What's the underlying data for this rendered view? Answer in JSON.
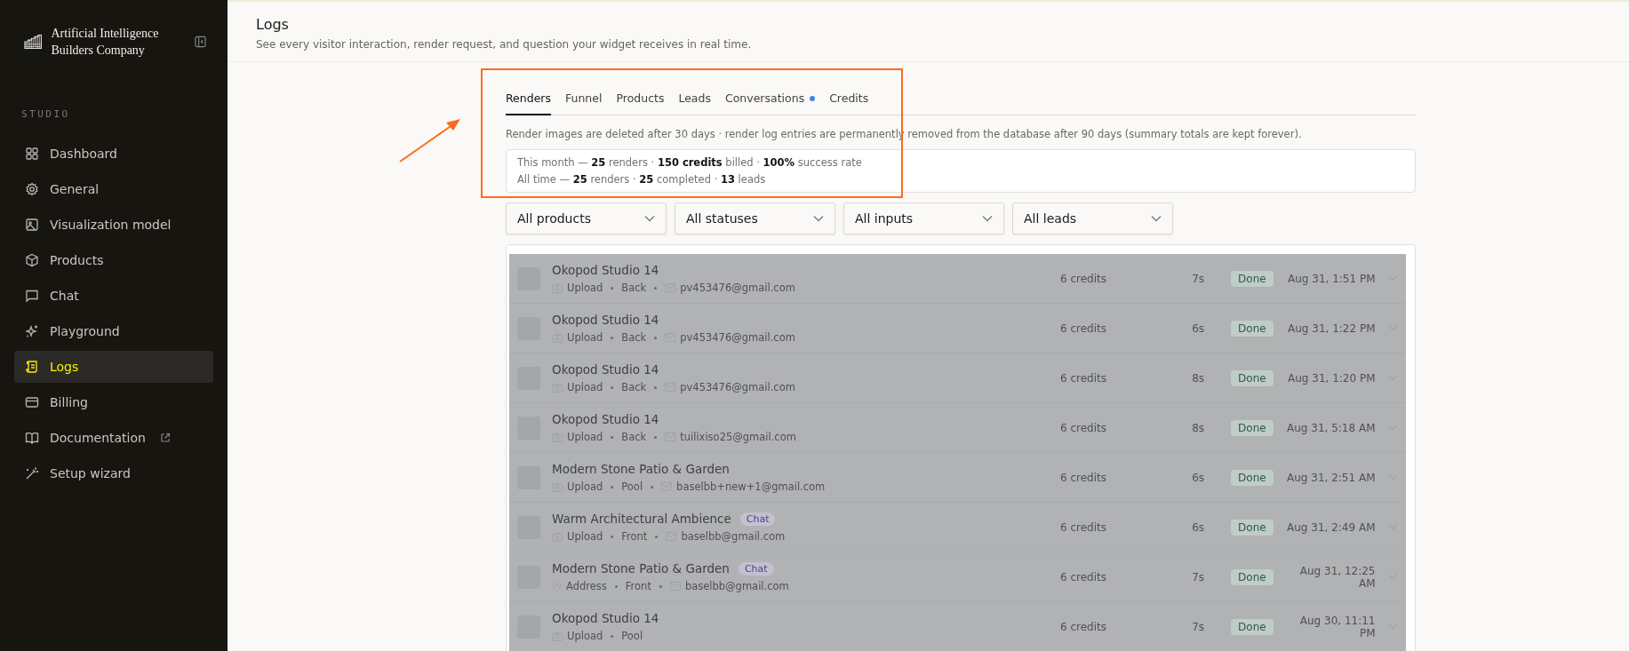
{
  "sidebar": {
    "brand": "Artificial Intelligence Builders Company",
    "section": "STUDIO",
    "items": [
      {
        "label": "Dashboard",
        "selected": false,
        "external": false
      },
      {
        "label": "General",
        "selected": false,
        "external": false
      },
      {
        "label": "Visualization model",
        "selected": false,
        "external": false
      },
      {
        "label": "Products",
        "selected": false,
        "external": false
      },
      {
        "label": "Chat",
        "selected": false,
        "external": false
      },
      {
        "label": "Playground",
        "selected": false,
        "external": false
      },
      {
        "label": "Logs",
        "selected": true,
        "external": false
      },
      {
        "label": "Billing",
        "selected": false,
        "external": false
      },
      {
        "label": "Documentation",
        "selected": false,
        "external": true
      },
      {
        "label": "Setup wizard",
        "selected": false,
        "external": false
      }
    ]
  },
  "header": {
    "title": "Logs",
    "subtitle": "See every visitor interaction, render request, and question your widget receives in real time."
  },
  "tabs": [
    {
      "label": "Renders",
      "selected": true,
      "unread": false
    },
    {
      "label": "Funnel",
      "selected": false,
      "unread": false
    },
    {
      "label": "Products",
      "selected": false,
      "unread": false
    },
    {
      "label": "Leads",
      "selected": false,
      "unread": false
    },
    {
      "label": "Conversations",
      "selected": false,
      "unread": true
    },
    {
      "label": "Credits",
      "selected": false,
      "unread": false
    }
  ],
  "notice": "Render images are deleted after 30 days · render log entries are permanently removed from the database after 90 days (summary totals are kept forever).",
  "summary": [
    "This month — **25** renders · **150 credits** billed · **100%** success rate",
    "All time — **25** renders · **25** completed · **13** leads"
  ],
  "filters": [
    "All products",
    "All statuses",
    "All inputs",
    "All leads"
  ],
  "rows": [
    {
      "title": "Okopod Studio 14",
      "tag": null,
      "kind": "upload",
      "input": "Upload",
      "view": "Back",
      "email": "pv453476@gmail.com",
      "credits": "6 credits",
      "duration": "7s",
      "status": "Done",
      "time": "Aug 31, 1:51 PM"
    },
    {
      "title": "Okopod Studio 14",
      "tag": null,
      "kind": "upload",
      "input": "Upload",
      "view": "Back",
      "email": "pv453476@gmail.com",
      "credits": "6 credits",
      "duration": "6s",
      "status": "Done",
      "time": "Aug 31, 1:22 PM"
    },
    {
      "title": "Okopod Studio 14",
      "tag": null,
      "kind": "upload",
      "input": "Upload",
      "view": "Back",
      "email": "pv453476@gmail.com",
      "credits": "6 credits",
      "duration": "8s",
      "status": "Done",
      "time": "Aug 31, 1:20 PM"
    },
    {
      "title": "Okopod Studio 14",
      "tag": null,
      "kind": "upload",
      "input": "Upload",
      "view": "Back",
      "email": "tuilixiso25@gmail.com",
      "credits": "6 credits",
      "duration": "8s",
      "status": "Done",
      "time": "Aug 31, 5:18 AM"
    },
    {
      "title": "Modern Stone Patio & Garden",
      "tag": null,
      "kind": "upload",
      "input": "Upload",
      "view": "Pool",
      "email": "baselbb+new+1@gmail.com",
      "credits": "6 credits",
      "duration": "6s",
      "status": "Done",
      "time": "Aug 31, 2:51 AM"
    },
    {
      "title": "Warm Architectural Ambience",
      "tag": "Chat",
      "kind": "upload",
      "input": "Upload",
      "view": "Front",
      "email": "baselbb@gmail.com",
      "credits": "6 credits",
      "duration": "6s",
      "status": "Done",
      "time": "Aug 31, 2:49 AM"
    },
    {
      "title": "Modern Stone Patio & Garden",
      "tag": "Chat",
      "kind": "address",
      "input": "Address",
      "view": "Front",
      "email": "baselbb@gmail.com",
      "credits": "6 credits",
      "duration": "7s",
      "status": "Done",
      "time": "Aug 31, 12:25 AM"
    },
    {
      "title": "Okopod Studio 14",
      "tag": null,
      "kind": "upload",
      "input": "Upload",
      "view": "Pool",
      "email": null,
      "credits": "6 credits",
      "duration": "7s",
      "status": "Done",
      "time": "Aug 30, 11:11 PM"
    }
  ]
}
